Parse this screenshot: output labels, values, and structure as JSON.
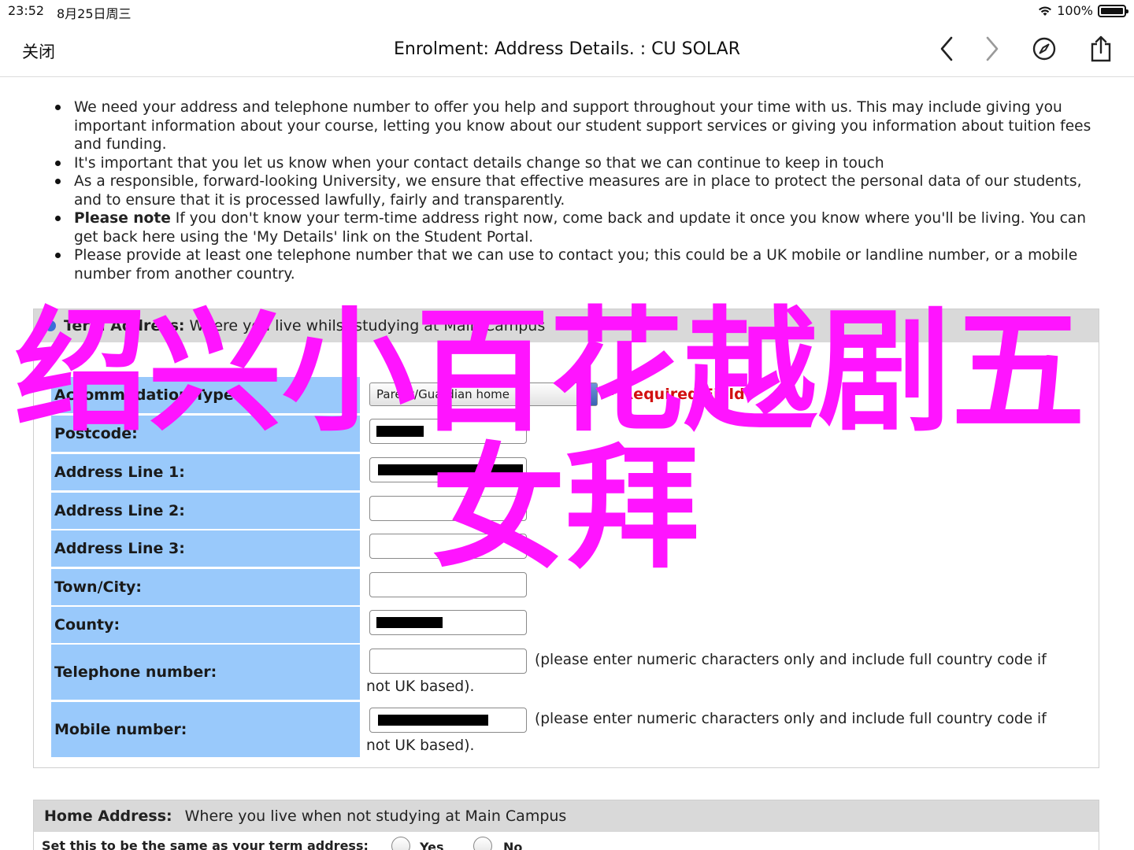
{
  "status_bar": {
    "time": "23:52",
    "date": "8月25日周三",
    "battery": "100%"
  },
  "nav": {
    "close_label": "关闭",
    "title": "Enrolment: Address Details. : CU SOLAR"
  },
  "bullets": [
    {
      "bold": "",
      "text": "We need your address and telephone number to offer you help and support throughout your time with us. This may include giving you important information about your course, letting you know about our student support services or giving you information about tuition fees and funding."
    },
    {
      "bold": "",
      "text": "It's important that you let us know when your contact details change so that we can continue to keep in touch"
    },
    {
      "bold": "",
      "text": "As a responsible, forward-looking University, we ensure that effective measures are in place to protect the personal data of our students, and to ensure that it is processed lawfully, fairly and transparently."
    },
    {
      "bold": "Please note",
      "text": " If you don't know your term-time address right now, come back and update it once you know where you'll be living. You can get back here using the 'My Details' link on the Student Portal."
    },
    {
      "bold": "",
      "text": "Please provide at least one telephone number that we can use to contact you; this could be a UK mobile or landline number, or a mobile number from another country."
    }
  ],
  "term_address": {
    "heading_bold": "Term Address:",
    "heading_text": " Where you live whilst studying at Main Campus",
    "accommodation_label": "Accommodation Type:",
    "accommodation_value": "Parent/Guardian home",
    "required_text": "* Required Field",
    "postcode_label": "Postcode:",
    "address1_label": "Address Line 1:",
    "address2_label": "Address Line 2:",
    "address3_label": "Address Line 3:",
    "town_label": "Town/City:",
    "county_label": "County:",
    "telephone_label": "Telephone number:",
    "mobile_label": "Mobile number:",
    "numeric_hint_1": "(please enter numeric characters only and include full country code if",
    "numeric_hint_2": "not UK based)."
  },
  "home_address": {
    "heading_bold": "Home Address:",
    "heading_text": "Where you live when not studying at Main Campus",
    "same_label": "Set this to be the same as your term address:",
    "yes_label": "Yes",
    "no_label": "No"
  },
  "watermark": {
    "line1": "绍兴小百花越剧五",
    "line2": "女拜",
    "color": "#ff14ff"
  }
}
